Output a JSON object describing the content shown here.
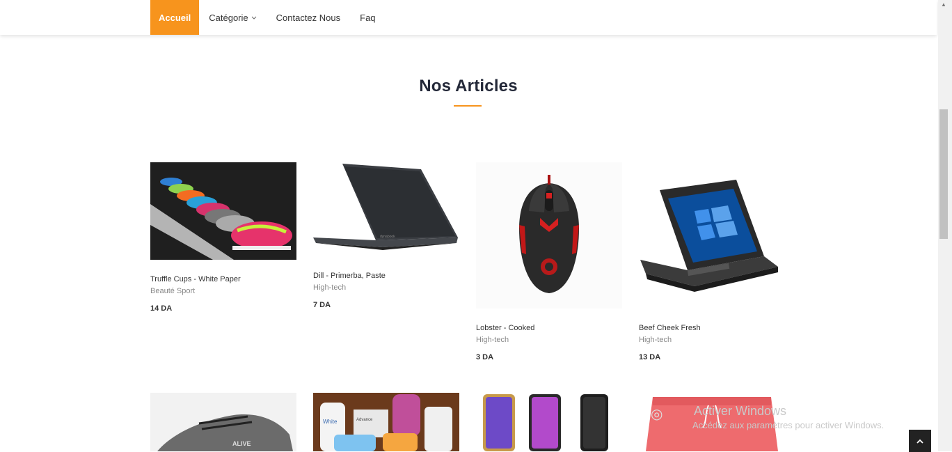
{
  "nav": {
    "items": [
      {
        "label": "Accueil",
        "active": true
      },
      {
        "label": "Catégorie",
        "dropdown": true
      },
      {
        "label": "Contactez Nous"
      },
      {
        "label": "Faq"
      }
    ],
    "dropdown_icon": "chevron-down-icon"
  },
  "section": {
    "title": "Nos Articles"
  },
  "products": [
    {
      "name": "Truffle Cups - White Paper",
      "category": "Beauté Sport",
      "price": "14 DA",
      "image": "sneakers-row"
    },
    {
      "name": "Dill - Primerba, Paste",
      "category": "High-tech",
      "price": "7 DA",
      "image": "laptop"
    },
    {
      "name": "Lobster - Cooked",
      "category": "High-tech",
      "price": "3 DA",
      "image": "gaming-mouse"
    },
    {
      "name": "Beef Cheek Fresh",
      "category": "High-tech",
      "price": "13 DA",
      "image": "rugged-tablet-laptop"
    },
    {
      "image": "grey-sneaker"
    },
    {
      "image": "toiletries-shelf"
    },
    {
      "image": "phone-car-holders"
    },
    {
      "image": "pink-shorts"
    }
  ],
  "watermark": {
    "title": "Activer Windows",
    "subtitle": "Accédez aux paramètres pour activer Windows."
  },
  "back_to_top_icon": "chevron-up-icon",
  "colors": {
    "accent": "#f7941d",
    "title": "#232838",
    "text": "#333333",
    "muted": "#888888"
  }
}
